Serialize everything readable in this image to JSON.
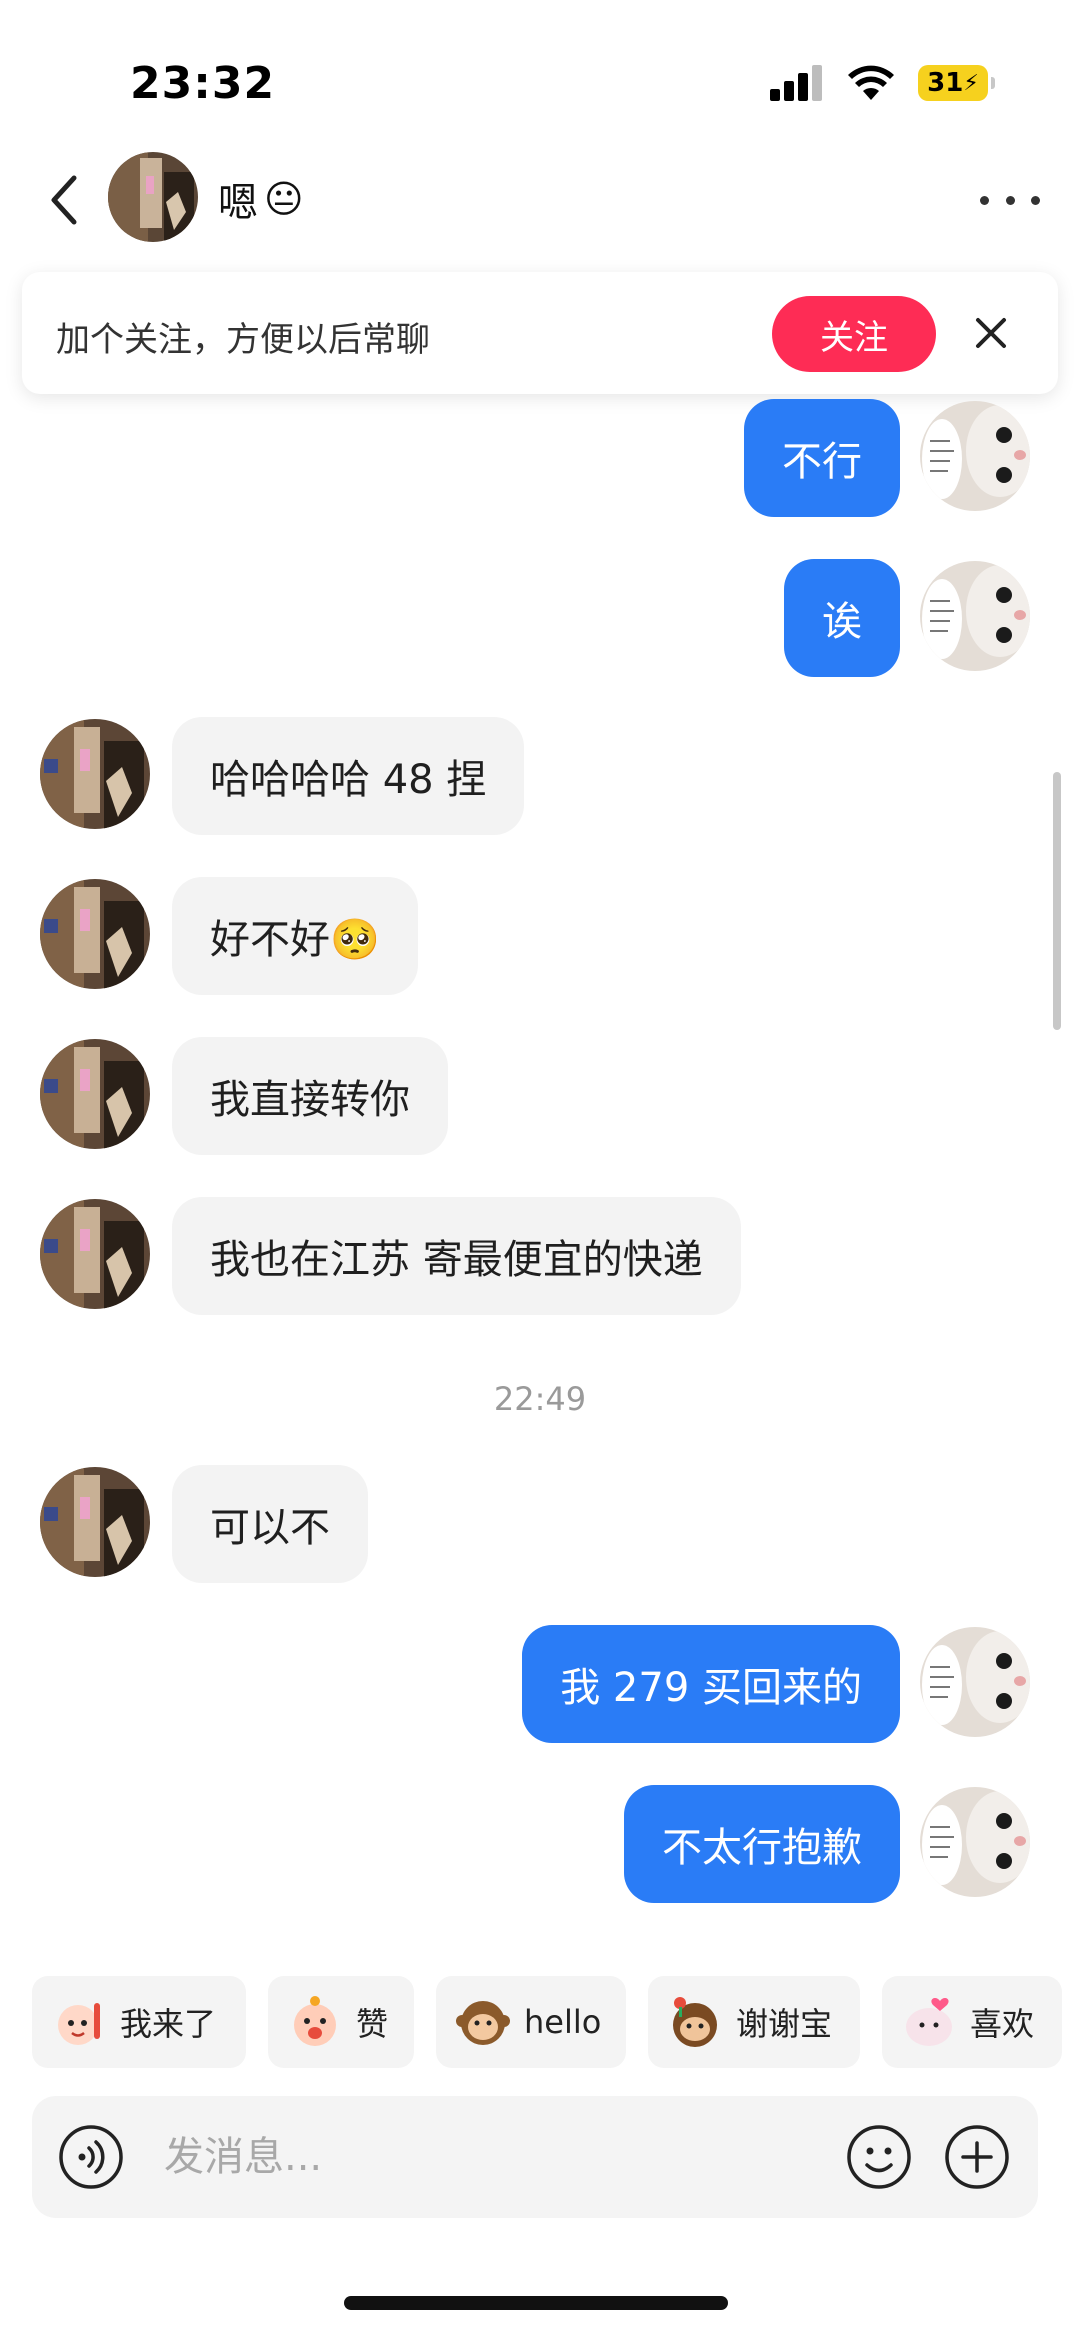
{
  "status_bar": {
    "time": "23:32",
    "battery": "31"
  },
  "header": {
    "contact_name": "嗯",
    "name_emoji": "😐",
    "more_icon": "more-dots-icon",
    "back_icon": "chevron-left-icon"
  },
  "follow_banner": {
    "text": "加个关注，方便以后常聊",
    "follow_label": "关注",
    "accent": "#fe2c55"
  },
  "messages": [
    {
      "from": "me",
      "text": "不行"
    },
    {
      "from": "me",
      "text": "诶"
    },
    {
      "from": "them",
      "text": "哈哈哈哈 48 捏"
    },
    {
      "from": "them",
      "text": "好不好🥺"
    },
    {
      "from": "them",
      "text": "我直接转你"
    },
    {
      "from": "them",
      "text": "我也在江苏 寄最便宜的快递"
    },
    {
      "from": "them",
      "text": "可以不"
    },
    {
      "from": "me",
      "text": "我 279 买回来的"
    },
    {
      "from": "me",
      "text": "不太行抱歉"
    }
  ],
  "timestamp": "22:49",
  "quick_replies": [
    {
      "label": "我来了",
      "icon": "sticker-waving-icon"
    },
    {
      "label": "赞",
      "icon": "sticker-cheer-icon"
    },
    {
      "label": "hello",
      "icon": "sticker-monkey-icon"
    },
    {
      "label": "谢谢宝",
      "icon": "sticker-monkey-flower-icon"
    },
    {
      "label": "喜欢",
      "icon": "sticker-heart-icon"
    }
  ],
  "input": {
    "placeholder": "发消息..."
  },
  "colors": {
    "sent_bubble": "#2a7cf6",
    "received_bubble": "#f3f3f3"
  }
}
